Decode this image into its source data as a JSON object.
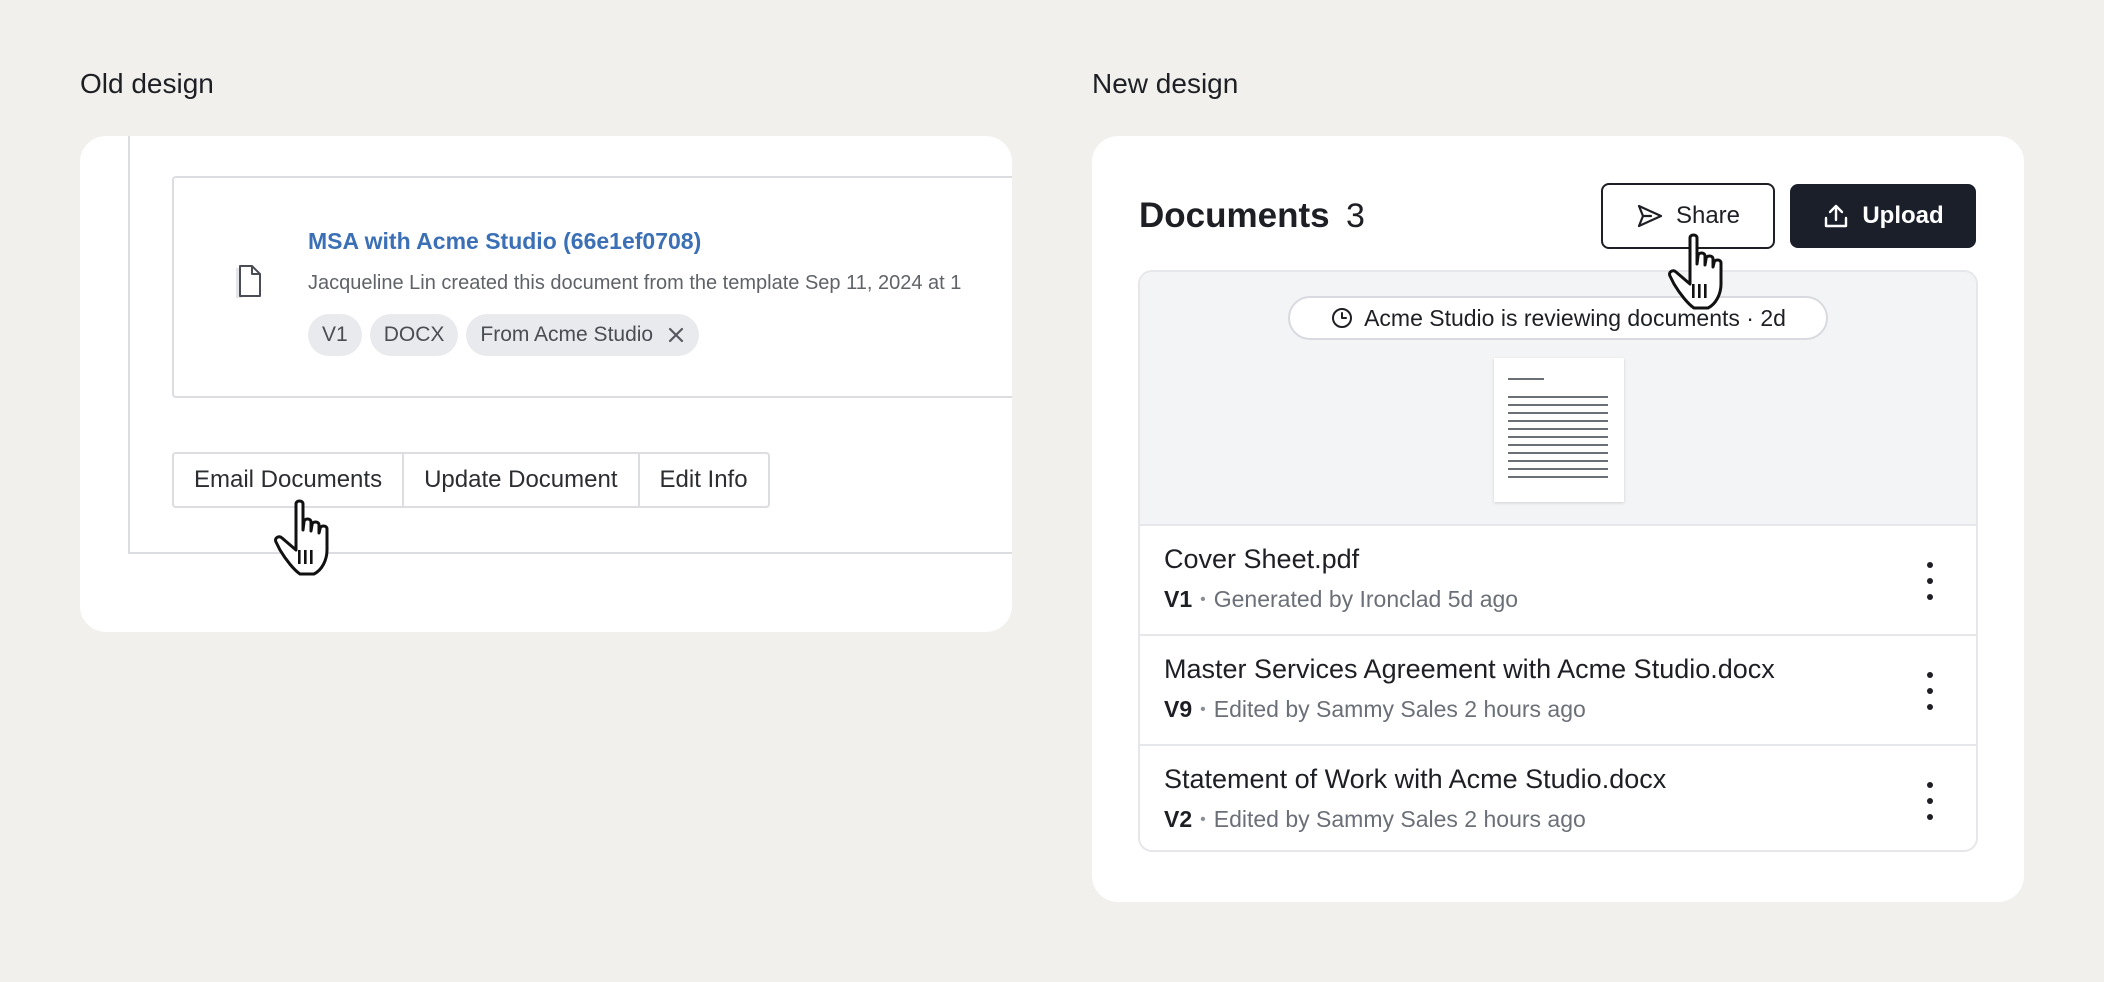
{
  "old_design": {
    "label": "Old design",
    "document": {
      "title": "MSA with Acme Studio (66e1ef0708)",
      "description": "Jacqueline Lin created this document from the template Sep 11, 2024 at 1",
      "tags": [
        "V1",
        "DOCX",
        "From Acme Studio"
      ]
    },
    "buttons": {
      "email": "Email Documents",
      "update": "Update Document",
      "edit": "Edit Info"
    }
  },
  "new_design": {
    "label": "New design",
    "header": {
      "title": "Documents",
      "count": "3"
    },
    "buttons": {
      "share": "Share",
      "upload": "Upload"
    },
    "status": "Acme Studio is reviewing documents · 2d",
    "documents": [
      {
        "name": "Cover Sheet.pdf",
        "version": "V1",
        "meta": "Generated by Ironclad 5d ago"
      },
      {
        "name": "Master Services Agreement with Acme Studio.docx",
        "version": "V9",
        "meta": "Edited by Sammy Sales 2 hours ago"
      },
      {
        "name": "Statement of Work with Acme Studio.docx",
        "version": "V2",
        "meta": "Edited by Sammy Sales 2 hours ago"
      }
    ]
  },
  "icons": {
    "file": "file-icon",
    "close": "close-icon",
    "send": "send-icon",
    "upload": "upload-icon",
    "clock": "clock-icon",
    "more": "kebab-icon",
    "cursor": "hand-cursor-icon"
  },
  "colors": {
    "background": "#f1f0ec",
    "link": "#3b6fb6",
    "primary": "#1b1f2a"
  }
}
